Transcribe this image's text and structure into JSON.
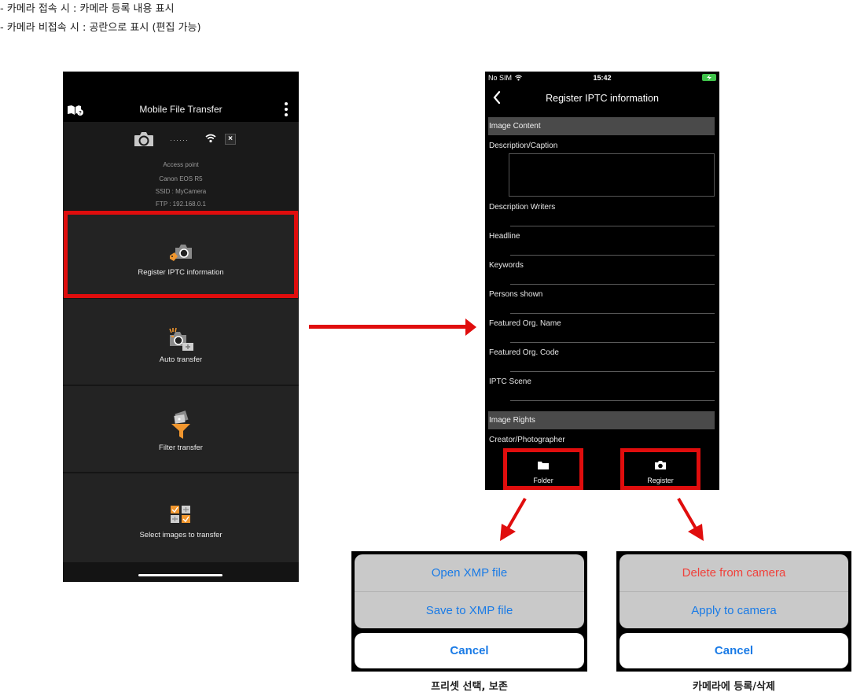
{
  "notes": [
    "- 카메라 접속 시  : 카메라 등록 내용 표시",
    "- 카메라 비접속 시 : 공란으로 표시  (편집 가능)"
  ],
  "left_phone": {
    "title": "Mobile File Transfer",
    "icons": {
      "help": "help-book-icon",
      "more": "more-vertical-icon"
    },
    "connection": {
      "status_dots": "······",
      "info": [
        "Access point",
        "Canon EOS R5",
        "SSID : MyCamera",
        "FTP : 192.168.0.1"
      ],
      "disconnect_label": "×"
    },
    "menu": [
      {
        "label": "Register IPTC information",
        "icon": "iptc-tag-camera-icon",
        "highlighted": true
      },
      {
        "label": "Auto transfer",
        "icon": "auto-transfer-icon"
      },
      {
        "label": "Filter transfer",
        "icon": "filter-funnel-icon"
      },
      {
        "label": "Select images to transfer",
        "icon": "select-images-grid-icon"
      }
    ]
  },
  "right_phone": {
    "status_bar": {
      "carrier": "No SIM",
      "time": "15:42"
    },
    "title": "Register IPTC information",
    "sections": [
      {
        "header": "Image Content",
        "fields": [
          {
            "label": "Description/Caption",
            "type": "textarea",
            "value": ""
          },
          {
            "label": "Description Writers",
            "value": ""
          },
          {
            "label": "Headline",
            "value": ""
          },
          {
            "label": "Keywords",
            "value": ""
          },
          {
            "label": "Persons shown",
            "value": ""
          },
          {
            "label": "Featured Org. Name",
            "value": ""
          },
          {
            "label": "Featured Org. Code",
            "value": ""
          },
          {
            "label": "IPTC Scene",
            "value": ""
          }
        ]
      },
      {
        "header": "Image Rights",
        "fields": [
          {
            "label": "Creator/Photographer",
            "value": ""
          }
        ]
      }
    ],
    "toolbar": [
      {
        "label": "Folder",
        "icon": "folder-icon"
      },
      {
        "label": "Register",
        "icon": "camera-icon"
      }
    ]
  },
  "sheets": [
    {
      "items": [
        {
          "label": "Open XMP file",
          "style": "default"
        },
        {
          "label": "Save to XMP file",
          "style": "default"
        }
      ],
      "cancel": "Cancel",
      "caption": "프리셋 선택, 보존"
    },
    {
      "items": [
        {
          "label": "Delete from camera",
          "style": "destructive"
        },
        {
          "label": "Apply to camera",
          "style": "default"
        }
      ],
      "cancel": "Cancel",
      "caption": "카메라에 등록/삭제"
    }
  ],
  "colors": {
    "highlight": "#e00d0d",
    "ios_blue": "#1a7be6",
    "ios_red": "#f0413b",
    "accent_orange": "#f0962e"
  }
}
